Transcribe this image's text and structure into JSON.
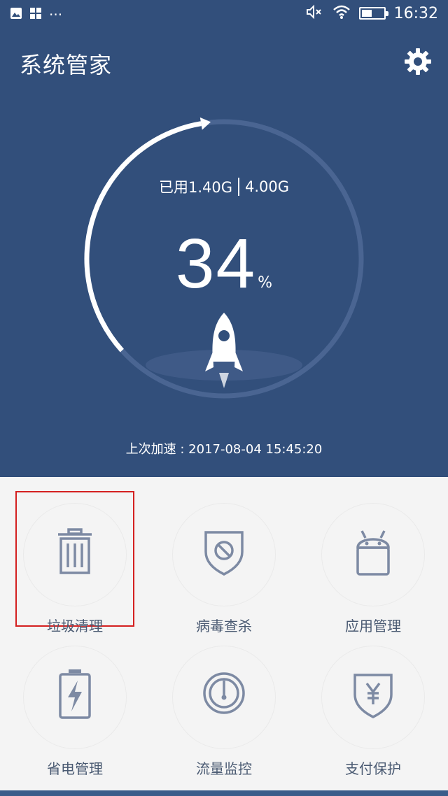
{
  "status_bar": {
    "time": "16:32",
    "battery_level": 0.45,
    "icons": [
      "image-icon",
      "app-grid-icon",
      "more-dots-icon",
      "mute-icon",
      "wifi-icon",
      "battery-icon"
    ],
    "more_dots": "···"
  },
  "header": {
    "title": "系统管家",
    "background": "#324f7b",
    "settings_icon": "gear-icon"
  },
  "memory": {
    "used": "已用1.40G",
    "total": "4.00G",
    "percent": "34",
    "percent_sign": "%",
    "usage_fraction": 0.34,
    "last_boost": "上次加速 : 2017-08-04 15:45:20"
  },
  "tools": [
    {
      "label": "垃圾清理",
      "icon": "trash-icon",
      "selected": true
    },
    {
      "label": "病毒查杀",
      "icon": "shield-block-icon"
    },
    {
      "label": "应用管理",
      "icon": "android-icon"
    },
    {
      "label": "省电管理",
      "icon": "battery-bolt-icon"
    },
    {
      "label": "流量监控",
      "icon": "gauge-icon"
    },
    {
      "label": "支付保护",
      "icon": "yen-shield-icon"
    }
  ],
  "colors": {
    "accent": "#324f7b",
    "icon": "#7d8aa3",
    "selection": "#d42020"
  }
}
